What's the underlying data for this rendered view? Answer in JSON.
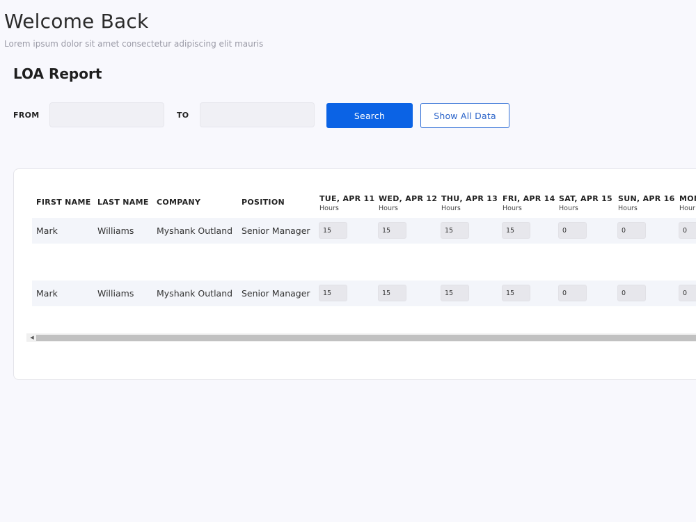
{
  "header": {
    "title": "Welcome Back",
    "subtitle": "Lorem ipsum dolor sit amet consectetur adipiscing elit mauris"
  },
  "report": {
    "title": "LOA Report"
  },
  "filters": {
    "from_label": "FROM",
    "from_value": "",
    "to_label": "TO",
    "to_value": "",
    "search_label": "Search",
    "show_all_label": "Show All Data"
  },
  "table": {
    "columns": {
      "first_name": "FIRST NAME",
      "last_name": "LAST NAME",
      "company": "COMPANY",
      "position": "POSITION"
    },
    "days": [
      {
        "label": "TUE, APR 11",
        "sub": "Hours"
      },
      {
        "label": "WED, APR 12",
        "sub": "Hours"
      },
      {
        "label": "THU, APR 13",
        "sub": "Hours"
      },
      {
        "label": "FRI, APR 14",
        "sub": "Hours"
      },
      {
        "label": "SAT, APR 15",
        "sub": "Hours"
      },
      {
        "label": "SUN, APR 16",
        "sub": "Hours"
      },
      {
        "label": "MON",
        "sub": "Hour"
      }
    ],
    "rows": [
      {
        "first_name": "Mark",
        "last_name": "Williams",
        "company": "Myshank Outland",
        "position": "Senior Manager",
        "hours": [
          "15",
          "15",
          "15",
          "15",
          "0",
          "0",
          "0"
        ]
      },
      {
        "first_name": "Mark",
        "last_name": "Williams",
        "company": "Myshank Outland",
        "position": "Senior Manager",
        "hours": [
          "15",
          "15",
          "15",
          "15",
          "0",
          "0",
          "0"
        ]
      }
    ]
  }
}
